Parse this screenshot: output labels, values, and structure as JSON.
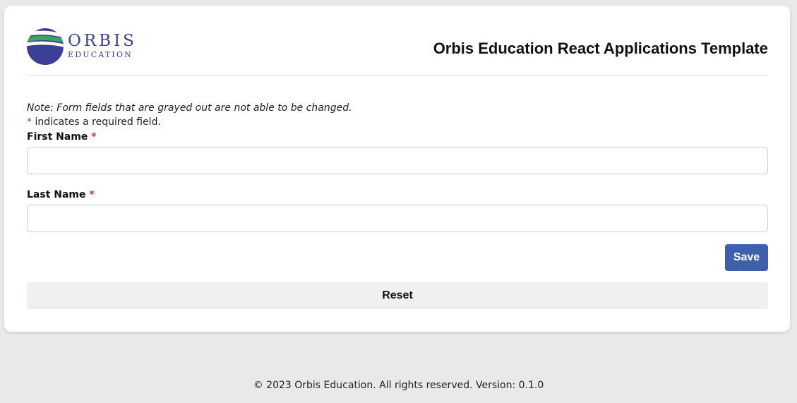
{
  "header": {
    "logo_word": "ORBIS",
    "logo_sub": "EDUCATION",
    "title": "Orbis Education React Applications Template"
  },
  "form": {
    "note": "Note: Form fields that are grayed out are not able to be changed.",
    "required_marker": "*",
    "required_note": " indicates a required field.",
    "fields": [
      {
        "label": "First Name",
        "value": "",
        "required": true
      },
      {
        "label": "Last Name",
        "value": "",
        "required": true
      }
    ],
    "save_label": "Save",
    "reset_label": "Reset"
  },
  "footer": {
    "text": "© 2023 Orbis Education. All rights reserved. Version: 0.1.0"
  },
  "colors": {
    "brand_navy": "#3b3f95",
    "brand_green": "#3aa55d",
    "primary_button": "#3e60ad",
    "required_red": "#c0392b"
  }
}
